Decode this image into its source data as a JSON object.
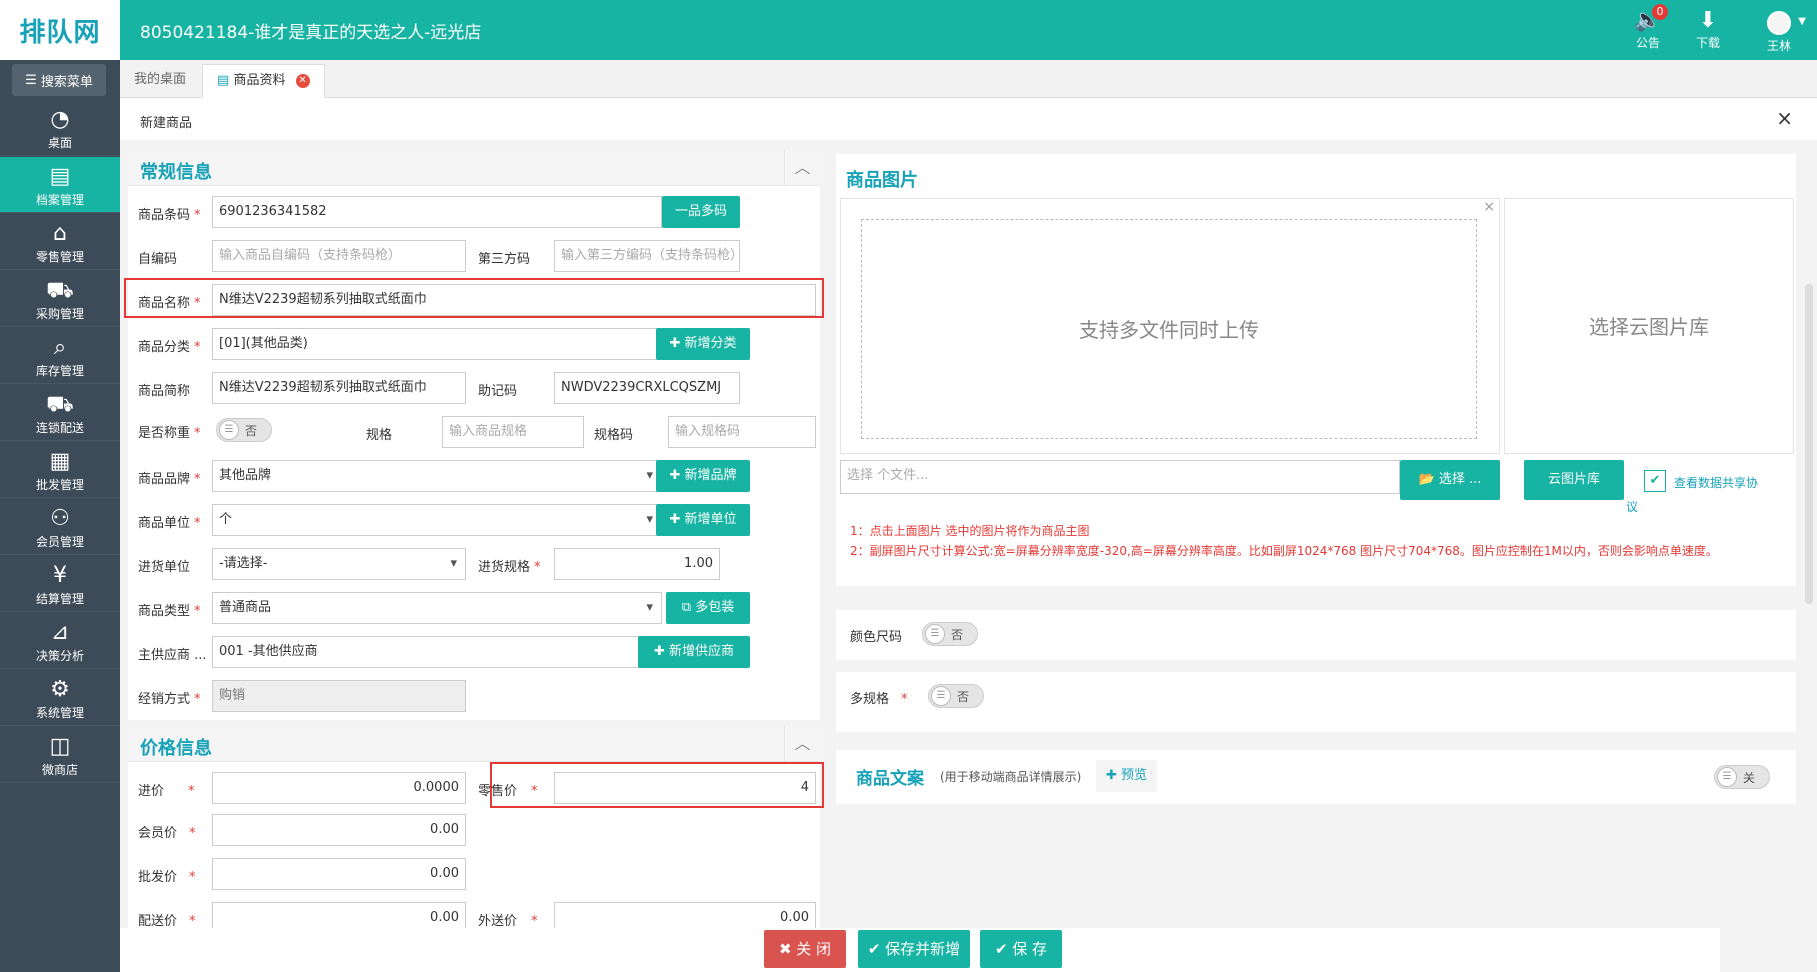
{
  "header": {
    "logo": "排队网",
    "shop_title": "8050421184-谁才是真正的天选之人-远光店",
    "announce_label": "公告",
    "announce_badge": "0",
    "download_label": "下载",
    "user_name": "王林"
  },
  "sidebar": {
    "search_menu": "搜索菜单",
    "items": [
      {
        "label": "桌面"
      },
      {
        "label": "档案管理"
      },
      {
        "label": "零售管理"
      },
      {
        "label": "采购管理"
      },
      {
        "label": "库存管理"
      },
      {
        "label": "连锁配送"
      },
      {
        "label": "批发管理"
      },
      {
        "label": "会员管理"
      },
      {
        "label": "结算管理"
      },
      {
        "label": "决策分析"
      },
      {
        "label": "系统管理"
      },
      {
        "label": "微商店"
      }
    ]
  },
  "tabs": {
    "desk": "我的桌面",
    "product": "商品资料"
  },
  "modal": {
    "title": "新建商品",
    "close": "×"
  },
  "general": {
    "title": "常规信息",
    "barcode_label": "商品条码",
    "barcode_value": "6901236341582",
    "multi_code_btn": "一品多码",
    "self_code_label": "自编码",
    "self_code_ph": "输入商品自编码（支持条码枪）",
    "third_code_label": "第三方码",
    "third_code_ph": "输入第三方编码（支持条码枪）",
    "name_label": "商品名称",
    "name_value": "N维达V2239超韧系列抽取式纸面巾",
    "category_label": "商品分类",
    "category_value": "[01](其他品类)",
    "add_category_btn": "✚ 新增分类",
    "short_name_label": "商品简称",
    "short_name_value": "N维达V2239超韧系列抽取式纸面巾",
    "mnemonic_label": "助记码",
    "mnemonic_value": "NWDV2239CRXLCQSZMJ",
    "weigh_label": "是否称重",
    "weigh_toggle": "否",
    "spec_label": "规格",
    "spec_ph": "输入商品规格",
    "spec_code_label": "规格码",
    "spec_code_ph": "输入规格码",
    "brand_label": "商品品牌",
    "brand_value": "其他品牌",
    "add_brand_btn": "✚ 新增品牌",
    "unit_label": "商品单位",
    "unit_value": "个",
    "add_unit_btn": "✚ 新增单位",
    "purchase_unit_label": "进货单位",
    "purchase_unit_value": "-请选择-",
    "purchase_spec_label": "进货规格",
    "purchase_spec_value": "1.00",
    "type_label": "商品类型",
    "type_value": "普通商品",
    "multi_pack_btn": "⧉ 多包装",
    "supplier_label": "主供应商 ...",
    "supplier_value": "001 -其他供应商",
    "add_supplier_btn": "✚ 新增供应商",
    "sales_mode_label": "经销方式",
    "sales_mode_value": "购销"
  },
  "price": {
    "title": "价格信息",
    "cost_label": "进价",
    "cost_value": "0.0000",
    "retail_label": "零售价",
    "retail_value": "4",
    "member_label": "会员价",
    "member_value": "0.00",
    "wholesale_label": "批发价",
    "wholesale_value": "0.00",
    "delivery_label": "配送价",
    "delivery_value": "0.00",
    "external_label": "外送价",
    "external_value": "0.00"
  },
  "images": {
    "title": "商品图片",
    "upload_text": "支持多文件同时上传",
    "cloud_text": "选择云图片库",
    "file_ph": "选择 个文件...",
    "choose_btn": "📂 选择 ...",
    "cloud_btn": "云图片库",
    "share_label": "查看数据共享协",
    "share_label_2": "议",
    "note1": "1：点击上面图片 选中的图片将作为商品主图",
    "note2": "2：副屏图片尺寸计算公式:宽=屏幕分辨率宽度-320,高=屏幕分辨率高度。比如副屏1024*768 图片尺寸704*768。图片应控制在1M以内，否则会影响点单速度。"
  },
  "color_size": {
    "label": "颜色尺码",
    "toggle": "否"
  },
  "multi_spec": {
    "label": "多规格",
    "toggle": "否"
  },
  "copy": {
    "title": "商品文案",
    "subtitle": "(用于移动端商品详情展示)",
    "preview": "✚ 预览",
    "toggle": "关"
  },
  "footer": {
    "close_btn": "✖ 关 闭",
    "save_new_btn": "✔ 保存并新增",
    "save_btn": "✔ 保 存"
  },
  "colors": {
    "accent": "#17b3a3",
    "sidebar": "#3d4a57",
    "danger": "#e53935",
    "title": "#17a2b8"
  }
}
